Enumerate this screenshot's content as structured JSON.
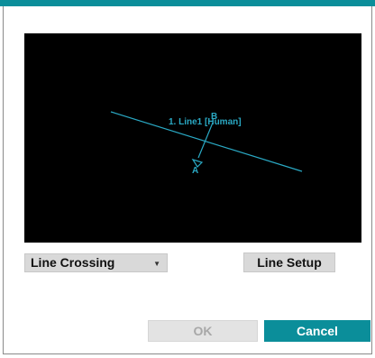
{
  "colors": {
    "accent": "#0b8e9a",
    "overlay": "#2aa9c4",
    "preview_bg": "#000000"
  },
  "preview": {
    "line_label": "1. Line1 [Human]",
    "point_a": "A",
    "point_b": "B"
  },
  "controls": {
    "event_type": "Line Crossing",
    "line_setup_label": "Line Setup"
  },
  "footer": {
    "ok_label": "OK",
    "cancel_label": "Cancel"
  }
}
